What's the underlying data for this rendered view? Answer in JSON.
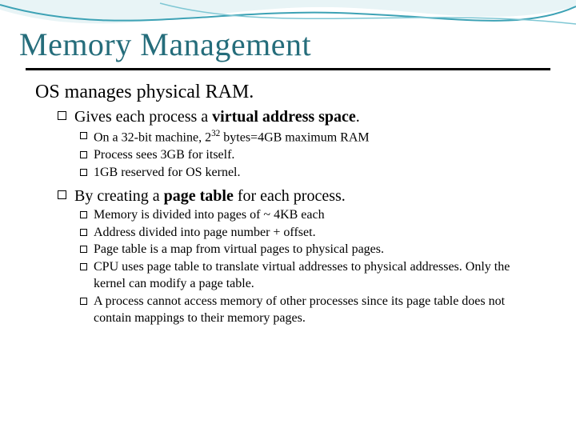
{
  "title": "Memory Management",
  "level1": "OS manages physical RAM.",
  "sub": [
    {
      "lead": "Gives each process a ",
      "bold": "virtual address space",
      "tail": ".",
      "items": [
        {
          "pre": "On a 32-bit machine, 2",
          "sup": "32",
          "post": " bytes=4GB maximum RAM"
        },
        {
          "text": "Process sees 3GB for itself."
        },
        {
          "text": "1GB reserved for OS kernel."
        }
      ]
    },
    {
      "lead": "By creating a ",
      "bold": "page table",
      "tail": " for each process.",
      "items": [
        {
          "text": "Memory is divided into pages of ~ 4KB each"
        },
        {
          "text": "Address divided into page number + offset."
        },
        {
          "text": "Page table is a map from virtual pages to physical pages."
        },
        {
          "text": "CPU uses page table to translate virtual addresses to physical addresses.  Only the kernel can modify a page table."
        },
        {
          "text": "A process cannot access memory of other processes since its page table does not contain mappings to their memory pages."
        }
      ]
    }
  ]
}
